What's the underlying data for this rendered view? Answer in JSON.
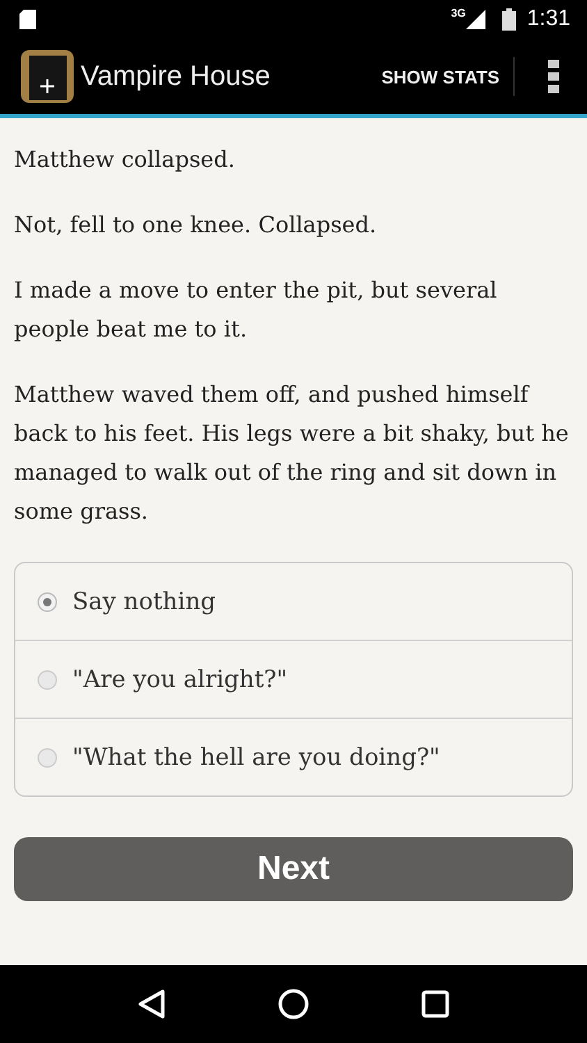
{
  "status_bar": {
    "time": "1:31",
    "network": "3G"
  },
  "app_bar": {
    "title": "Vampire House",
    "action": "SHOW STATS"
  },
  "paragraphs": [
    "Matthew collapsed.",
    "Not, fell to one knee. Collapsed.",
    "I made a move to enter the pit, but several people beat me to it.",
    "Matthew waved them off, and pushed himself back to his feet. His legs were a bit shaky, but he managed to walk out of the ring and sit down in some grass."
  ],
  "choices": [
    {
      "label": "Say nothing",
      "selected": true
    },
    {
      "label": "\"Are you alright?\"",
      "selected": false
    },
    {
      "label": "\"What the hell are you doing?\"",
      "selected": false
    }
  ],
  "next_button": "Next"
}
